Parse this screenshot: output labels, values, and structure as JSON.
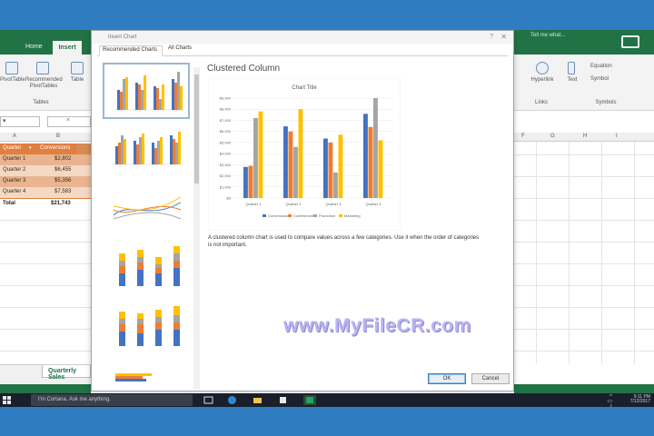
{
  "excel": {
    "tabs": [
      "Home",
      "Insert"
    ],
    "ribbon_left": {
      "pivot_label": "PivotTable",
      "recommended_label": "Recommended PivotTables",
      "table_label": "Table",
      "group_label": "Tables"
    },
    "ribbon_right": {
      "hyperlink_label": "Hyperlink",
      "links_group": "Links",
      "text_label": "Text",
      "equation_label": "Equation",
      "symbol_label": "Symbol",
      "symbols_group": "Symbols",
      "tell_me": "Tell me what..."
    },
    "col_letters": [
      "F",
      "G",
      "H",
      "I"
    ],
    "table": {
      "headers": [
        "Quarter",
        "Conversions"
      ],
      "rows": [
        {
          "label": "Quarter 1",
          "value": "$2,802"
        },
        {
          "label": "Quarter 2",
          "value": "$6,455"
        },
        {
          "label": "Quarter 3",
          "value": "$5,356"
        },
        {
          "label": "Quarter 4",
          "value": "$7,583"
        }
      ],
      "total_label": "Total",
      "total_value": "$21,743"
    },
    "sheet_tab": "Quarterly Sales"
  },
  "dialog": {
    "title": "Insert Chart",
    "help": "?",
    "close": "✕",
    "tabs": [
      "Recommended Charts",
      "All Charts"
    ],
    "preview_title": "Clustered Column",
    "description": "A clustered column chart is used to compare values across a few categories. Use it when the order of categories is not important.",
    "ok_label": "OK",
    "cancel_label": "Cancel"
  },
  "chart_data": {
    "type": "bar",
    "title": "Chart Title",
    "categories": [
      "Quarter 1",
      "Quarter 2",
      "Quarter 3",
      "Quarter 4"
    ],
    "ylim": [
      0,
      9000
    ],
    "yticks": [
      0,
      1000,
      2000,
      3000,
      4000,
      5000,
      6000,
      7000,
      8000,
      9000
    ],
    "ytick_labels": [
      "$0",
      "$1,000",
      "$2,000",
      "$3,000",
      "$4,000",
      "$5,000",
      "$6,000",
      "$7,000",
      "$8,000",
      "$9,000"
    ],
    "series": [
      {
        "name": "Conversions",
        "color": "#4472c4",
        "values": [
          2802,
          6455,
          5356,
          7583
        ]
      },
      {
        "name": "Conferences",
        "color": "#ed7d31",
        "values": [
          2900,
          6000,
          5000,
          6400
        ]
      },
      {
        "name": "Promotion",
        "color": "#a5a5a5",
        "values": [
          7200,
          4600,
          2300,
          9000
        ]
      },
      {
        "name": "Marketing",
        "color": "#ffc000",
        "values": [
          7800,
          8000,
          5700,
          5200
        ]
      }
    ],
    "legend": "bottom",
    "grid": true
  },
  "watermark": "www.MyFileCR.com",
  "taskbar": {
    "search_placeholder": "I'm Cortana. Ask me anything.",
    "time": "9:11 PM",
    "date": "7/12/2017"
  }
}
